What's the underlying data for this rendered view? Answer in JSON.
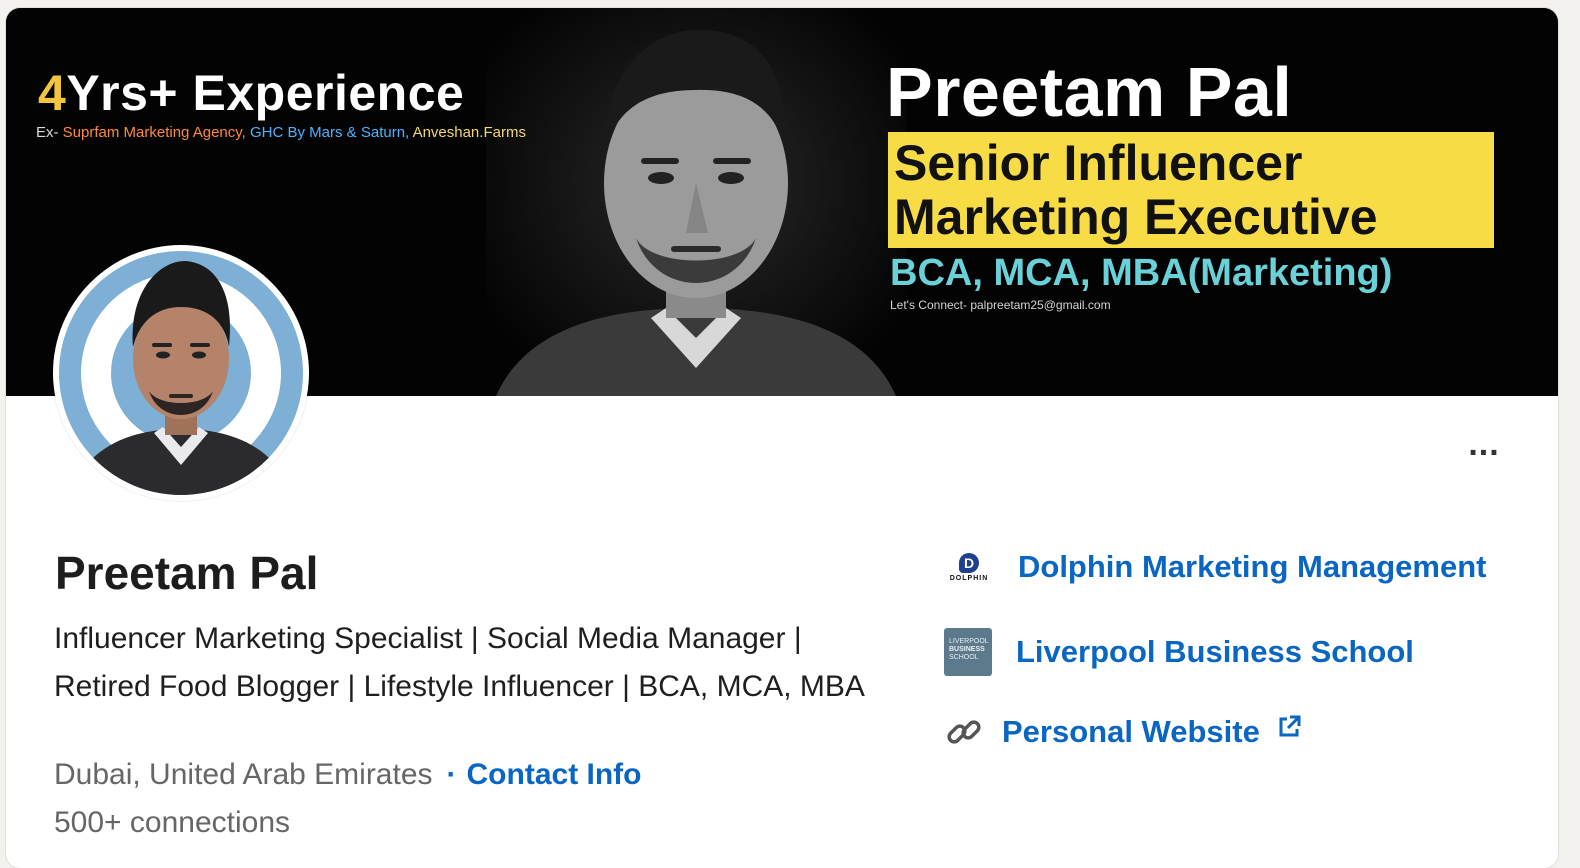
{
  "banner": {
    "experience_prefix": "4",
    "experience_text": "Yrs+ Experience",
    "ex_label": "Ex-",
    "ex_companies": [
      "Suprfam Marketing Agency,",
      "GHC By Mars & Saturn,",
      "Anveshan.Farms"
    ],
    "name": "Preetam Pal",
    "title_line1": "Senior Influencer",
    "title_line2": "Marketing Executive",
    "degrees": "BCA, MCA, MBA(Marketing)",
    "connect_line": "Let's Connect- palpreetam25@gmail.com",
    "title_box_color": "#f7dc45",
    "degrees_color": "#6ad1d9"
  },
  "profile": {
    "name": "Preetam Pal",
    "headline": "Influencer Marketing Specialist | Social Media Manager | Retired Food Blogger | Lifestyle Influencer | BCA, MCA, MBA",
    "location": "Dubai, United Arab Emirates",
    "separator": "·",
    "contact_info": "Contact Info",
    "connections": "500+ connections",
    "more_icon": "ellipsis-icon",
    "more_label": "..."
  },
  "links": {
    "company": {
      "name": "Dolphin Marketing Management",
      "logo_mark": "D",
      "logo_word": "DOLPHIN"
    },
    "school": {
      "name": "Liverpool Business School",
      "logo_lines": [
        "LIVERPOOL",
        "BUSINESS",
        "SCHOOL"
      ]
    },
    "website": {
      "name": "Personal Website",
      "icon": "link-chain-icon",
      "external_icon": "external-link-icon"
    }
  },
  "colors": {
    "link_blue": "#0a66c2",
    "banner_bg": "#030303",
    "avatar_bg": "#7eb0d6"
  }
}
